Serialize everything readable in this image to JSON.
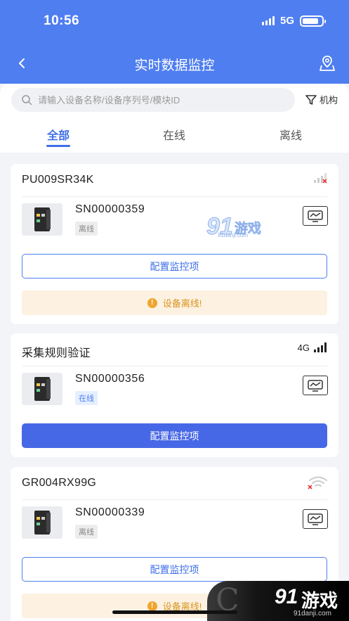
{
  "status_bar": {
    "time": "10:56",
    "network": "5G",
    "battery_level": 0.85
  },
  "header": {
    "title": "实时数据监控",
    "back_icon": "chevron-left-icon",
    "map_icon": "map-pin-icon"
  },
  "search": {
    "placeholder": "请输入设备名称/设备序列号/模块ID",
    "filter_label": "机构"
  },
  "tabs": [
    {
      "label": "全部",
      "active": true
    },
    {
      "label": "在线",
      "active": false
    },
    {
      "label": "离线",
      "active": false
    }
  ],
  "cards": [
    {
      "title": "PU009SR34K",
      "signal": "cellular-no-signal-icon",
      "sn": "SN00000359",
      "status": "离线",
      "config_label": "配置监控项",
      "warning": "设备离线!"
    },
    {
      "title": "采集规则验证",
      "signal": "cellular-full-signal-icon",
      "network": "4G",
      "sn": "SN00000356",
      "status": "在线",
      "config_label": "配置监控项"
    },
    {
      "title": "GR004RX99G",
      "signal": "wifi-disconnected-icon",
      "sn": "SN00000339",
      "status": "离线",
      "config_label": "配置监控项",
      "warning": "设备离线!"
    }
  ],
  "watermark": {
    "number": "91",
    "text": "游戏",
    "url": "91danji.com"
  },
  "corner_logo": {
    "number": "91",
    "text": "游戏",
    "url": "91danji.com"
  },
  "colors": {
    "primary": "#4f7ef0",
    "button": "#4768e6",
    "warning": "#d9951f",
    "warning_bg": "#fdf1e1"
  }
}
